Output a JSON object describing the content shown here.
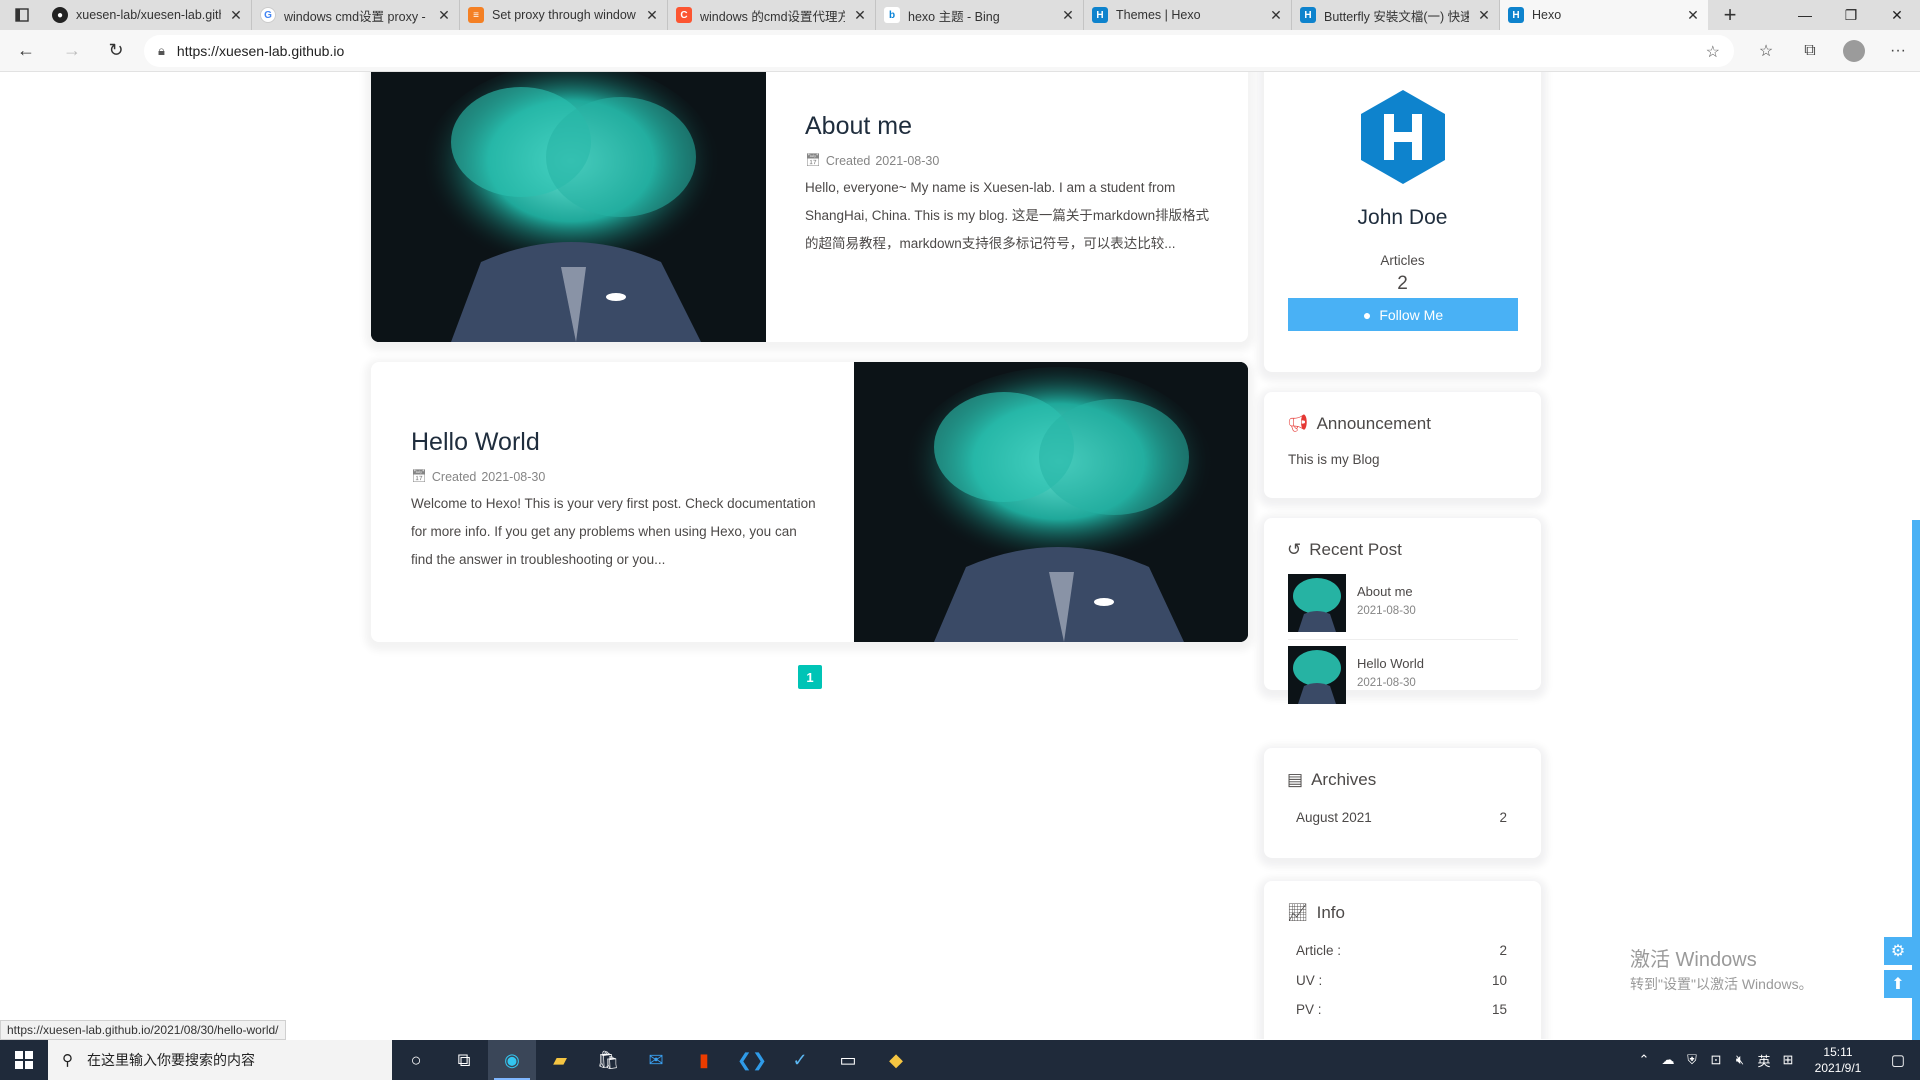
{
  "browser": {
    "tabs": [
      {
        "title": "xuesen-lab/xuesen-lab.githu",
        "favicon": "github-icon",
        "active": false
      },
      {
        "title": "windows cmd设置 proxy -",
        "favicon": "google-icon",
        "active": false
      },
      {
        "title": "Set proxy through window",
        "favicon": "stackoverflow-icon",
        "active": false
      },
      {
        "title": "windows 的cmd设置代理方",
        "favicon": "csdn-icon",
        "active": false
      },
      {
        "title": "hexo 主题 - Bing",
        "favicon": "bing-icon",
        "active": false
      },
      {
        "title": "Themes | Hexo",
        "favicon": "hexo-icon",
        "active": false
      },
      {
        "title": "Butterfly 安裝文檔(一) 快速",
        "favicon": "hexo-icon",
        "active": false
      },
      {
        "title": "Hexo",
        "favicon": "hexo-icon",
        "active": true
      }
    ],
    "url": "https://xuesen-lab.github.io",
    "status_url": "https://xuesen-lab.github.io/2021/08/30/hello-world/"
  },
  "posts": [
    {
      "title": "About me",
      "meta_label": "Created",
      "date": "2021-08-30",
      "excerpt": "Hello, everyone~ My name is Xuesen-lab. I am a student from ShangHai, China. This is my blog. 这是一篇关于markdown排版格式的超简易教程，markdown支持很多标记符号，可以表达比较..."
    },
    {
      "title": "Hello World",
      "meta_label": "Created",
      "date": "2021-08-30",
      "excerpt": "Welcome to Hexo! This is your very first post. Check documentation for more info. If you get any problems when using Hexo, you can find the answer in troubleshooting or you..."
    }
  ],
  "pagination": {
    "current": "1"
  },
  "author": {
    "name": "John Doe",
    "articles_label": "Articles",
    "articles_count": "2",
    "follow_label": "Follow Me"
  },
  "announcement": {
    "title": "Announcement",
    "text": "This is my Blog"
  },
  "recent": {
    "title": "Recent Post",
    "items": [
      {
        "title": "About me",
        "date": "2021-08-30"
      },
      {
        "title": "Hello World",
        "date": "2021-08-30"
      }
    ]
  },
  "archives": {
    "title": "Archives",
    "month": "August 2021",
    "count": "2"
  },
  "info": {
    "title": "Info",
    "rows": [
      {
        "label": "Article :",
        "value": "2"
      },
      {
        "label": "UV :",
        "value": "10"
      },
      {
        "label": "PV :",
        "value": "15"
      }
    ]
  },
  "watermark": {
    "line1": "激活 Windows",
    "line2": "转到\"设置\"以激活 Windows。"
  },
  "taskbar": {
    "search_placeholder": "在这里输入你要搜索的内容",
    "ime": "英",
    "time": "15:11",
    "date": "2021/9/1"
  },
  "colors": {
    "accent": "#49b1f5",
    "pagination": "#00c4b6",
    "hexo_logo": "#0e83cd",
    "announcement_icon": "#e53935"
  }
}
